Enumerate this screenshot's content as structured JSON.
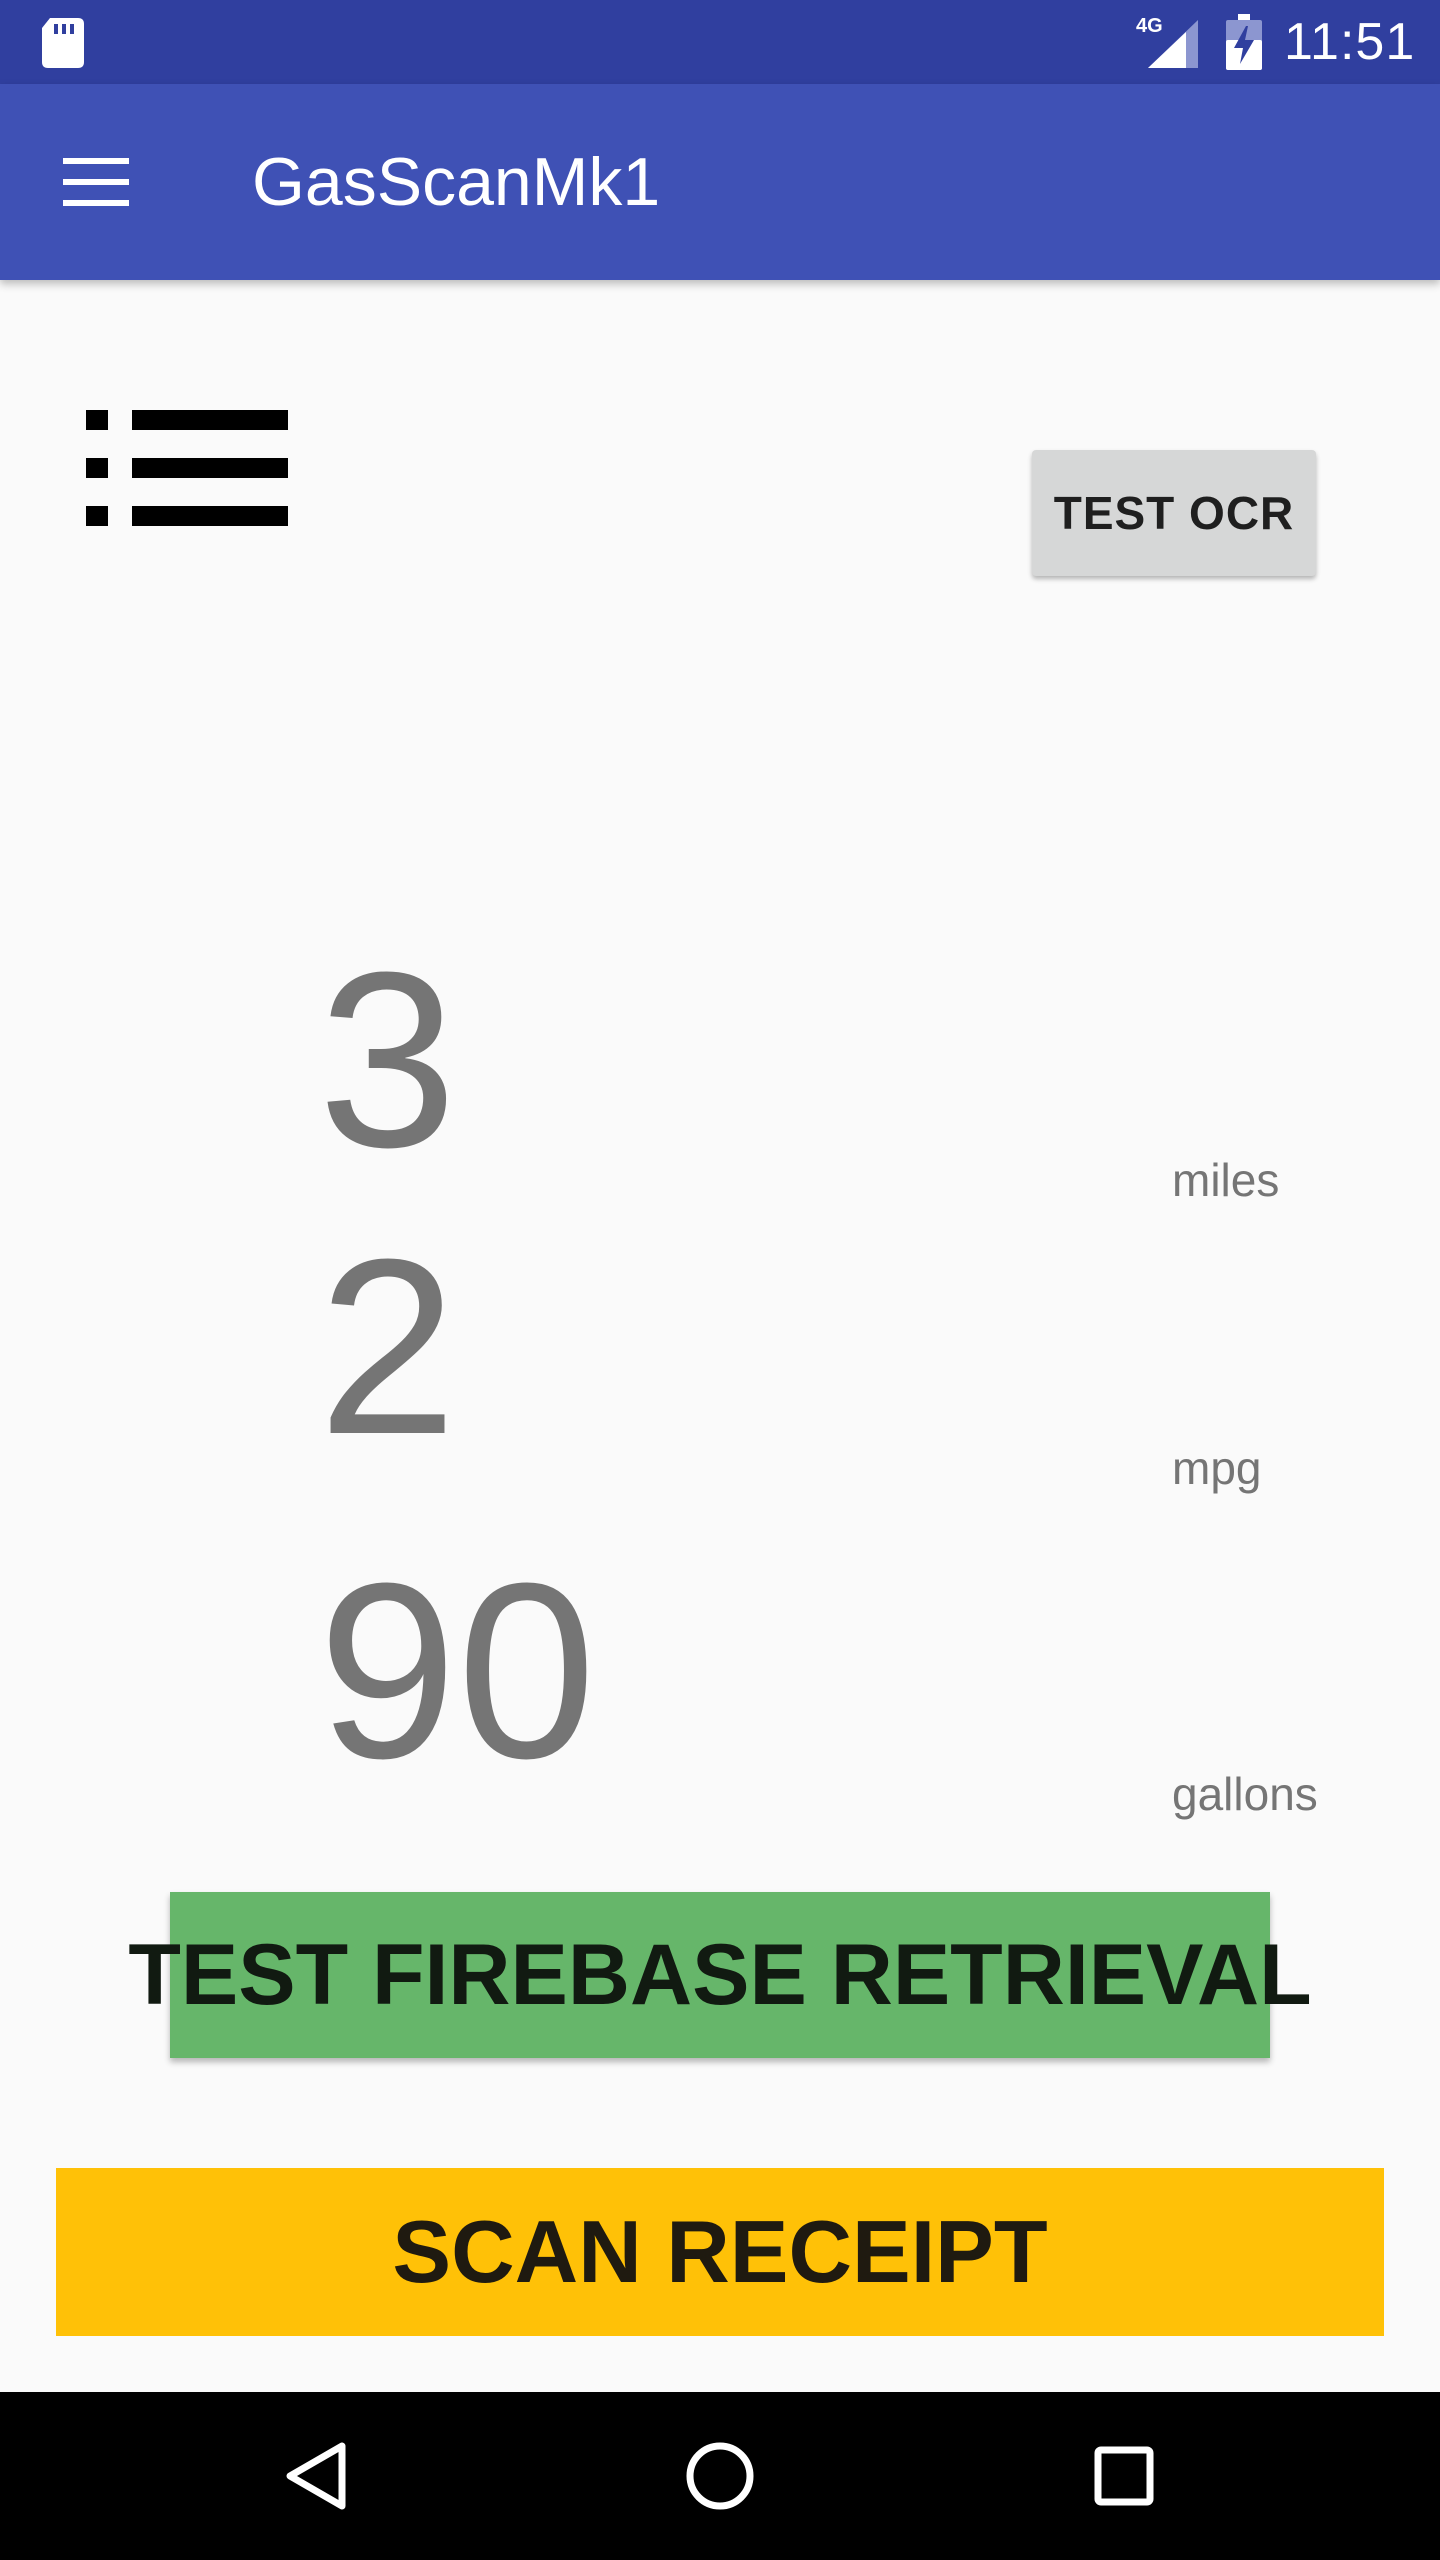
{
  "status_bar": {
    "network_label": "4G",
    "time": "11:51",
    "icons": [
      "sd-card-icon",
      "signal-4g-icon",
      "battery-charging-icon"
    ]
  },
  "app_bar": {
    "title": "GasScanMk1",
    "menu_icon": "hamburger-menu-icon"
  },
  "main": {
    "list_icon": "list-icon",
    "test_ocr_label": "TEST OCR",
    "miles_value": "3",
    "miles_unit": "miles",
    "mpg_value": "2",
    "mpg_unit": "mpg",
    "gallons_value": "90",
    "gallons_unit": "gallons",
    "firebase_label": "TEST FIREBASE RETRIEVAL",
    "scan_label": "SCAN RECEIPT"
  },
  "nav_bar": {
    "icons": [
      "back-icon",
      "home-icon",
      "recents-icon"
    ]
  },
  "colors": {
    "status_bar": "#303f9f",
    "app_bar": "#3f51b5",
    "background": "#fafafa",
    "test_ocr_button": "#d6d7d7",
    "firebase_button": "#66b66a",
    "scan_button": "#ffc107",
    "number_text": "#757575",
    "nav_bar": "#000000"
  }
}
